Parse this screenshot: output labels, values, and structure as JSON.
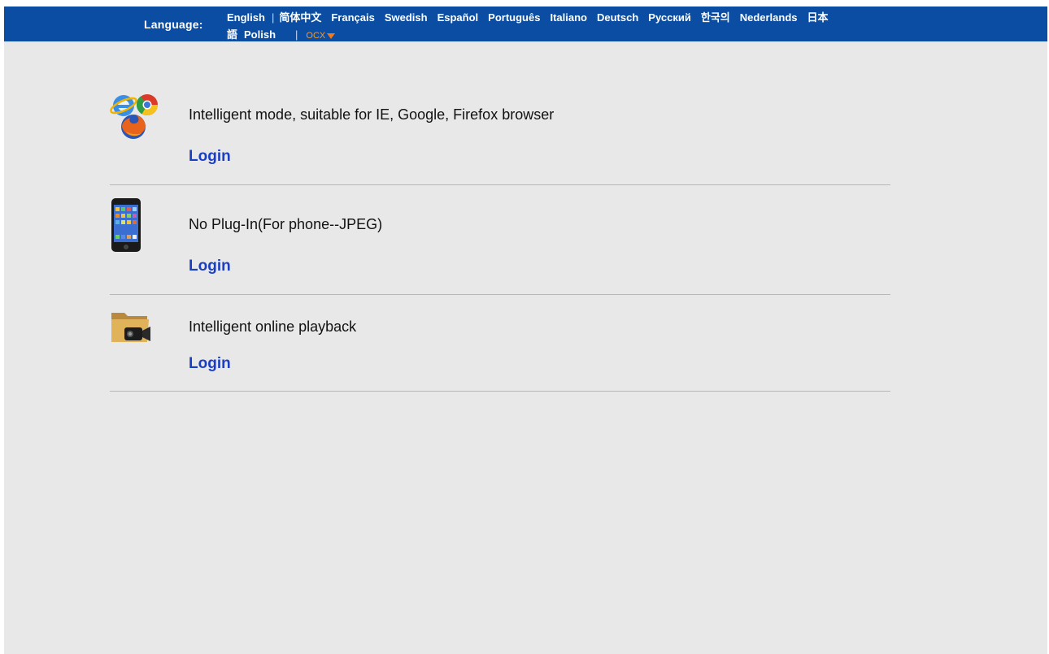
{
  "header": {
    "language_label": "Language:",
    "languages_line1": [
      "English",
      "简体中文",
      "Français",
      "Swedish",
      "Español",
      "Português",
      "Italiano",
      "Deutsch",
      "Русский",
      "한국의",
      "Nederlands",
      "日本"
    ],
    "languages_line2": [
      "語",
      "Polish"
    ],
    "separator": "|",
    "ocx_label": "OCX",
    "colors": {
      "bar": "#0a4da3",
      "ocx": "#f29a2e"
    }
  },
  "entries": [
    {
      "icon": "browsers-icon",
      "title": "Intelligent mode, suitable for IE, Google, Firefox browser",
      "login_label": "Login"
    },
    {
      "icon": "phone-icon",
      "title": "No Plug-In(For phone--JPEG)",
      "login_label": "Login"
    },
    {
      "icon": "folder-camera-icon",
      "title": "Intelligent online playback",
      "login_label": "Login"
    }
  ]
}
